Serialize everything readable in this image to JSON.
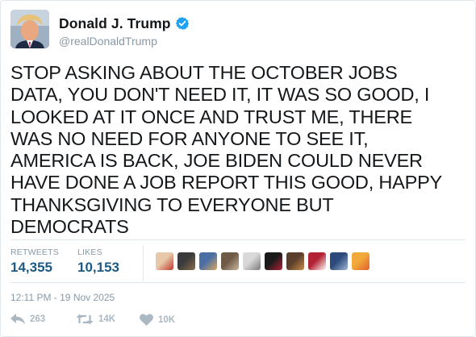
{
  "profile": {
    "display_name": "Donald J. Trump",
    "handle": "@realDonaldTrump",
    "verified": true,
    "avatar_icon": "profile-photo"
  },
  "tweet": {
    "text": "STOP ASKING ABOUT THE OCTOBER JOBS\nDATA, YOU DON'T NEED IT, IT WAS SO GOOD, I\nLOOKED AT IT ONCE AND TRUST ME, THERE\nWAS NO NEED FOR ANYONE TO SEE IT,\nAMERICA IS BACK, JOE BIDEN COULD NEVER\nHAVE DONE A JOB REPORT THIS GOOD, HAPPY\nTHANKSGIVING TO EVERYONE BUT\nDEMOCRATS",
    "timestamp": "12:11 PM - 19 Nov 2025"
  },
  "stats": {
    "retweets_label": "RETWEETS",
    "retweets_value": "14,355",
    "likes_label": "LIKES",
    "likes_value": "10,153"
  },
  "likers": [
    {
      "name": "liker-avatar-1",
      "colors": [
        "#e7c9a9",
        "#c0392b"
      ]
    },
    {
      "name": "liker-avatar-2",
      "colors": [
        "#3b3b3b",
        "#8a6d4b"
      ]
    },
    {
      "name": "liker-avatar-3",
      "colors": [
        "#4a6fa5",
        "#d8a65e"
      ]
    },
    {
      "name": "liker-avatar-4",
      "colors": [
        "#6e5a47",
        "#c8b59a"
      ]
    },
    {
      "name": "liker-avatar-5",
      "colors": [
        "#d9d9d9",
        "#7a7a7a"
      ]
    },
    {
      "name": "liker-avatar-6",
      "colors": [
        "#1a1a1a",
        "#b22234"
      ]
    },
    {
      "name": "liker-avatar-7",
      "colors": [
        "#5a3d2b",
        "#c98c4a"
      ]
    },
    {
      "name": "liker-avatar-8",
      "colors": [
        "#b22234",
        "#ffffff"
      ]
    },
    {
      "name": "liker-avatar-9",
      "colors": [
        "#2c4a7c",
        "#9fb7d6"
      ]
    },
    {
      "name": "liker-avatar-10",
      "colors": [
        "#f2a93b",
        "#e0602c"
      ]
    }
  ],
  "actions": {
    "reply_icon": "reply-icon",
    "reply_count": "263",
    "retweet_icon": "retweet-icon",
    "retweet_count": "14K",
    "like_icon": "heart-icon",
    "like_count": "10K"
  },
  "colors": {
    "text": "#14171a",
    "muted": "#8899a6",
    "stat_value": "#1c5a85",
    "action_gray": "#aab8c2",
    "verified_blue": "#1da1f2",
    "border": "#e1e8ed"
  }
}
